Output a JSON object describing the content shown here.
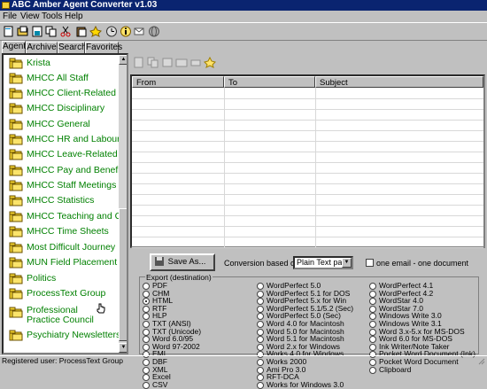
{
  "window": {
    "title": "ABC Amber Agent Converter v1.03"
  },
  "menu": [
    {
      "label": "File"
    },
    {
      "label": "View"
    },
    {
      "label": "Tools"
    },
    {
      "label": "Help"
    }
  ],
  "toolbar_icons": [
    "new-icon",
    "open-icon",
    "save-icon",
    "copy-icon",
    "cut-icon",
    "paste-icon",
    "wizard-icon",
    "clock-icon",
    "info-icon",
    "forward-icon",
    "globe-icon"
  ],
  "tabs": [
    {
      "label": "Agent",
      "active": true
    },
    {
      "label": "Archive"
    },
    {
      "label": "Search"
    },
    {
      "label": "Favorites"
    }
  ],
  "folders": [
    "Krista",
    "MHCC All Staff",
    "MHCC Client-Related",
    "MHCC Disciplinary",
    "MHCC General",
    "MHCC HR and Labour",
    "MHCC Leave-Related",
    "MHCC Pay and Benefits",
    "MHCC Staff Meetings",
    "MHCC Statistics",
    "MHCC Teaching and CE",
    "MHCC Time Sheets",
    "Most Difficult Journey",
    "MUN Field Placement",
    "Politics",
    "ProcessText Group",
    "Professional Practice Council",
    "Psychiatry Newsletters"
  ],
  "message_list": {
    "columns": [
      "From",
      "To",
      "Subject"
    ]
  },
  "convert": {
    "save_as": "Save As...",
    "conversion_label": "Conversion based on:",
    "conversion_value": "Plain Text part",
    "one_email_label": "one email - one document",
    "export_label": "Export (destination)",
    "formats_col1": [
      "PDF",
      "CHM",
      "HTML",
      "RTF",
      "HLP",
      "TXT (ANSI)",
      "TXT (Unicode)",
      "Word 6.0/95",
      "Word 97-2002",
      "EML",
      "DBF",
      "XML",
      "Excel",
      "CSV"
    ],
    "formats_col2": [
      "WordPerfect 5.0",
      "WordPerfect 5.1 for DOS",
      "WordPerfect 5.x for Win",
      "WordPerfect 5.1/5.2 (Sec)",
      "WordPerfect 5.0 (Sec)",
      "Word 4.0 for Macintosh",
      "Word 5.0 for Macintosh",
      "Word 5.1 for Macintosh",
      "Word 2.x for Windows",
      "Works 4.0 for Windows",
      "Works 2000",
      "Ami Pro 3.0",
      "RFT-DCA",
      "Works for Windows 3.0"
    ],
    "formats_col3": [
      "WordPerfect 4.1",
      "WordPerfect 4.2",
      "WordStar 4.0",
      "WordStar 7.0",
      "Windows Write 3.0",
      "Windows Write 3.1",
      "Word 3.x-5.x for MS-DOS",
      "Word 6.0 for MS-DOS",
      "Ink Writer/Note Taker",
      "Pocket Word Document (Ink)",
      "Pocket Word Document",
      "Clipboard"
    ],
    "selected_format": "HTML"
  },
  "status": {
    "text": "Registered user: ProcessText Group"
  },
  "colors": {
    "titlebar": "#0a2470",
    "link": "#008000",
    "face": "#c0c0c0"
  }
}
